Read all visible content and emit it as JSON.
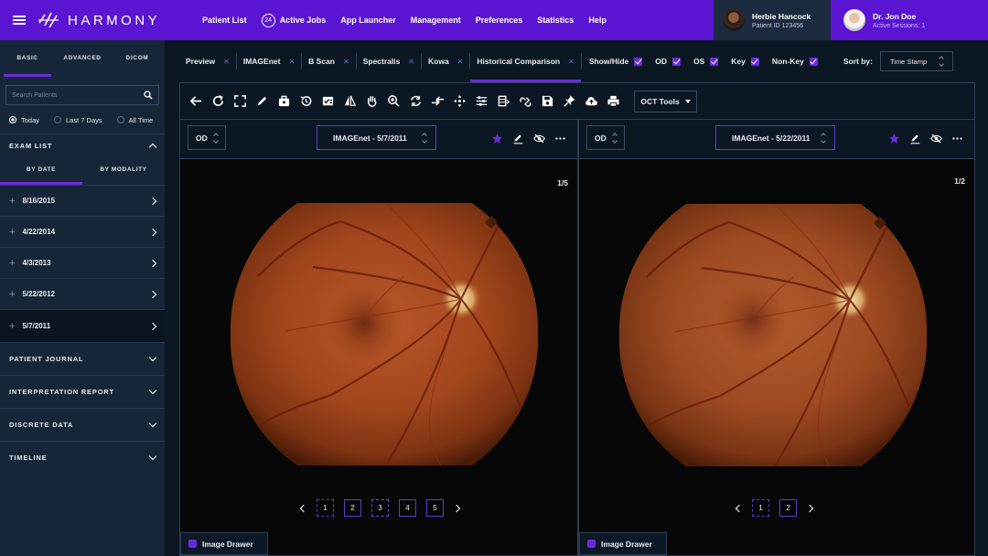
{
  "app": {
    "name": "HARMONY"
  },
  "nav": [
    {
      "label": "Patient List"
    },
    {
      "label": "Active Jobs",
      "badge": "24"
    },
    {
      "label": "App Launcher"
    },
    {
      "label": "Management"
    },
    {
      "label": "Preferences"
    },
    {
      "label": "Statistics"
    },
    {
      "label": "Help"
    }
  ],
  "patient": {
    "name": "Herbie Hancock",
    "id_text": "Patient ID 123456"
  },
  "user": {
    "name": "Dr. Jon Doe",
    "sessions": "Active Sessions: 1"
  },
  "sidebar": {
    "tabs": [
      "BASIC",
      "ADVANCED",
      "DICOM"
    ],
    "active_tab": 0,
    "search_placeholder": "Search Patients",
    "filters": [
      {
        "label": "Today",
        "selected": true
      },
      {
        "label": "Last 7 Days",
        "selected": false
      },
      {
        "label": "All Time",
        "selected": false
      }
    ],
    "exam_list_label": "EXAM LIST",
    "exam_tabs": [
      "BY DATE",
      "BY MODALITY"
    ],
    "exams": [
      "8/16/2015",
      "4/22/2014",
      "4/3/2013",
      "5/22/2012",
      "5/7/2011"
    ],
    "selected_exam": 4,
    "sections": [
      "PATIENT JOURNAL",
      "INTERPRETATION REPORT",
      "DISCRETE DATA",
      "TIMELINE"
    ]
  },
  "viewer_tabs": [
    {
      "label": "Preview",
      "active": false
    },
    {
      "label": "IMAGEnet",
      "active": false
    },
    {
      "label": "B Scan",
      "active": false
    },
    {
      "label": "Spectralis",
      "active": false
    },
    {
      "label": "Kowa",
      "active": false
    },
    {
      "label": "Historical Comparison",
      "active": true
    }
  ],
  "show_hide": {
    "label": "Show/Hide",
    "options": [
      {
        "label": "OD",
        "checked": true
      },
      {
        "label": "OS",
        "checked": true
      },
      {
        "label": "Key",
        "checked": true
      },
      {
        "label": "Non-Key",
        "checked": true
      }
    ]
  },
  "sort": {
    "label": "Sort by:",
    "value": "Time Stamp"
  },
  "toolbar": {
    "icons": [
      "back-arrow-icon",
      "refresh-icon",
      "fit-screen-icon",
      "pen-icon",
      "toolbox-icon",
      "history-icon",
      "checklist-icon",
      "flip-icon",
      "pan-hand-icon",
      "zoom-in-icon",
      "rotate-icon",
      "compare-icon",
      "move-icon",
      "adjust-icon",
      "layout-icon",
      "link-edit-icon",
      "save-icon",
      "pin-icon",
      "upload-icon",
      "print-icon"
    ],
    "oct_tools": "OCT Tools"
  },
  "panels": [
    {
      "eye": "OD",
      "image": "IMAGEnet - 5/7/2011",
      "counter": "1/5",
      "pages": [
        "1",
        "2",
        "3",
        "4",
        "5"
      ],
      "current_page": 2,
      "drawer": "Image Drawer"
    },
    {
      "eye": "OD",
      "image": "IMAGEnet - 5/22/2011",
      "counter": "1/2",
      "pages": [
        "1",
        "2"
      ],
      "current_page": 0,
      "drawer": "Image Drawer"
    }
  ],
  "colors": {
    "brand": "#5a14d2",
    "accent": "#6a2bdb",
    "background": "#0c1724",
    "sidebar": "#162638"
  }
}
